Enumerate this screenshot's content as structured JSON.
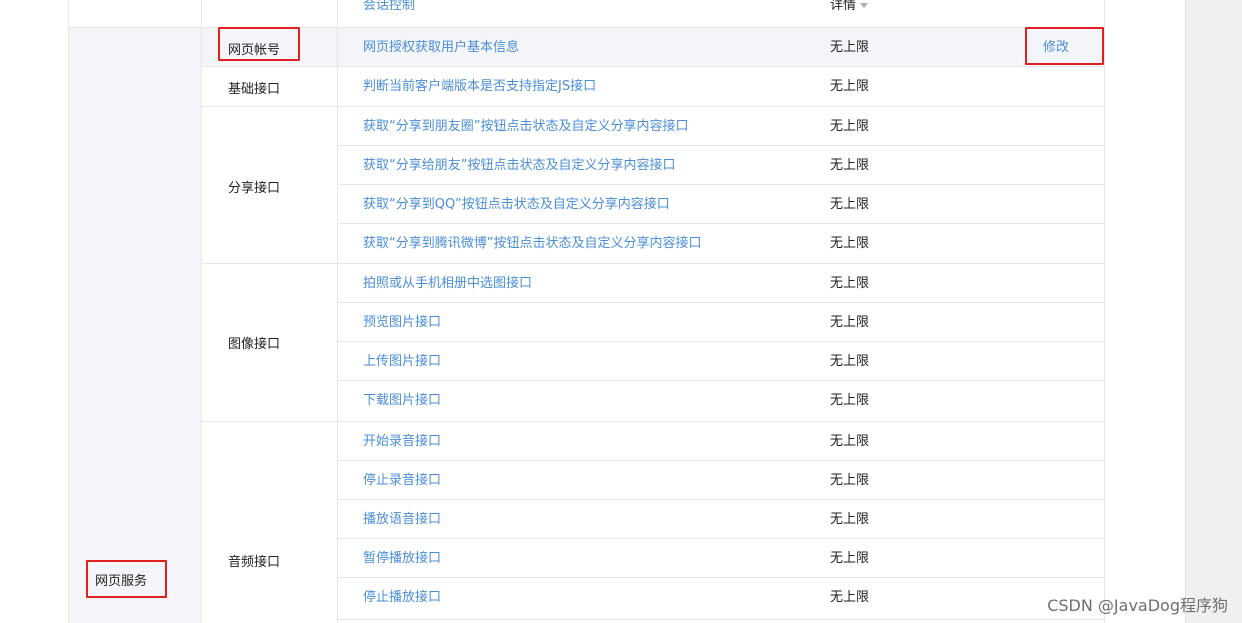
{
  "table": {
    "header_row": {
      "name": "会话控制",
      "limit": "详情"
    },
    "category": {
      "label": "网页服务"
    },
    "groups": [
      {
        "label": "网页帐号"
      },
      {
        "label": "基础接口"
      },
      {
        "label": "分享接口"
      },
      {
        "label": "图像接口"
      },
      {
        "label": "音频接口"
      }
    ],
    "rows": [
      {
        "name": "网页授权获取用户基本信息",
        "limit": "无上限",
        "action": "修改"
      },
      {
        "name": "判断当前客户端版本是否支持指定JS接口",
        "limit": "无上限"
      },
      {
        "name": "获取“分享到朋友圈”按钮点击状态及自定义分享内容接口",
        "limit": "无上限"
      },
      {
        "name": "获取“分享给朋友”按钮点击状态及自定义分享内容接口",
        "limit": "无上限"
      },
      {
        "name": "获取“分享到QQ”按钮点击状态及自定义分享内容接口",
        "limit": "无上限"
      },
      {
        "name": "获取“分享到腾讯微博”按钮点击状态及自定义分享内容接口",
        "limit": "无上限"
      },
      {
        "name": "拍照或从手机相册中选图接口",
        "limit": "无上限"
      },
      {
        "name": "预览图片接口",
        "limit": "无上限"
      },
      {
        "name": "上传图片接口",
        "limit": "无上限"
      },
      {
        "name": "下载图片接口",
        "limit": "无上限"
      },
      {
        "name": "开始录音接口",
        "limit": "无上限"
      },
      {
        "name": "停止录音接口",
        "limit": "无上限"
      },
      {
        "name": "播放语音接口",
        "limit": "无上限"
      },
      {
        "name": "暂停播放接口",
        "limit": "无上限"
      },
      {
        "name": "停止播放接口",
        "limit": "无上限"
      }
    ]
  },
  "watermark": "CSDN @JavaDog程序狗",
  "colors": {
    "link": "#4a8ed8",
    "highlight": "#e02020",
    "category_bg": "#f4f5f9"
  }
}
